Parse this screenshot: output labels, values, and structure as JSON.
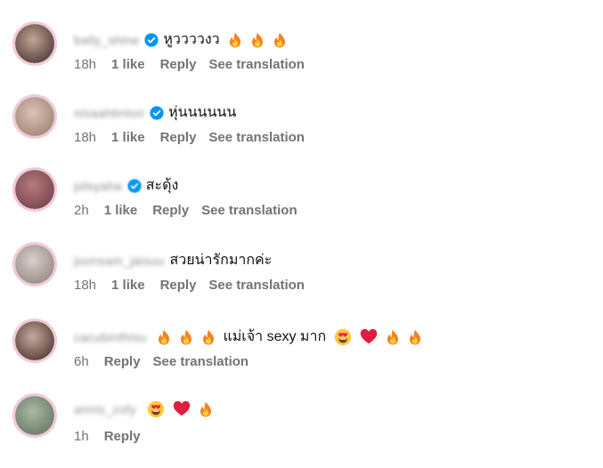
{
  "comments": [
    {
      "username": "bally_shine",
      "verified": true,
      "text": "หูววววงว",
      "emojis_before": [],
      "emojis_after": [
        "fire-icon",
        "fire-icon",
        "fire-icon"
      ],
      "time": "18h",
      "likes": "1 like",
      "reply": "Reply",
      "translate": "See translation",
      "avatar_colors": [
        "#c2a596",
        "#5a4540"
      ]
    },
    {
      "username": "nisaahtinton",
      "verified": true,
      "text": "หุ่นนนนนน",
      "emojis_before": [],
      "emojis_after": [],
      "time": "18h",
      "likes": "1 like",
      "reply": "Reply",
      "translate": "See translation",
      "avatar_colors": [
        "#d9c3b8",
        "#a88a7a"
      ]
    },
    {
      "username": "pilsyaha",
      "verified": true,
      "text": "สะดุ้ง",
      "emojis_before": [],
      "emojis_after": [],
      "time": "2h",
      "likes": "1 like",
      "reply": "Reply",
      "translate": "See translation",
      "avatar_colors": [
        "#b87a7a",
        "#7a4a52"
      ]
    },
    {
      "username": "joonsam_jaisuu",
      "verified": false,
      "text": "สวยน่ารักมากค่ะ",
      "emojis_before": [],
      "emojis_after": [],
      "time": "18h",
      "likes": "1 like",
      "reply": "Reply",
      "translate": "See translation",
      "avatar_colors": [
        "#d8d0cb",
        "#9c908a"
      ]
    },
    {
      "username": "cacubinthisu",
      "verified": false,
      "text": "แม่เจ้า sexy มาก",
      "emojis_before": [
        "fire-icon",
        "fire-icon",
        "fire-icon"
      ],
      "emojis_after": [
        "heart-eyes-icon",
        "red-heart-icon",
        "fire-icon",
        "fire-icon"
      ],
      "time": "6h",
      "likes": "",
      "reply": "Reply",
      "translate": "See translation",
      "avatar_colors": [
        "#c8a89c",
        "#5c463f"
      ]
    },
    {
      "username": "annis_zofy",
      "verified": false,
      "text": "",
      "emojis_before": [],
      "emojis_after": [
        "heart-eyes-icon",
        "red-heart-icon",
        "fire-icon"
      ],
      "time": "1h",
      "likes": "",
      "reply": "Reply",
      "translate": "",
      "avatar_colors": [
        "#a9b9a3",
        "#6f7f6c"
      ]
    }
  ],
  "colors": {
    "verified_badge": "#0095f6",
    "meta_text": "#737373",
    "avatar_ring": "#f3c9d9"
  }
}
